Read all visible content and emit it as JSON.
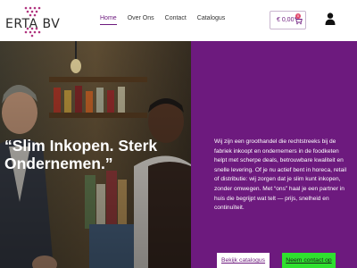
{
  "header": {
    "logo_text": "ERTA BV",
    "nav": [
      {
        "label": "Home",
        "active": true
      },
      {
        "label": "Over Ons",
        "active": false
      },
      {
        "label": "Contact",
        "active": false
      },
      {
        "label": "Catalogus",
        "active": false
      }
    ],
    "cart": {
      "amount": "€ 0,00",
      "count": "0",
      "icon": "cart-icon"
    },
    "user_icon": "user-icon"
  },
  "hero": {
    "headline": "“Slim Inkopen. Sterk Ondernemen.”",
    "body": "Wij zijn een groothandel die rechtstreeks bij de fabriek inkoopt en ondernemers in de foodketen helpt met scherpe deals, betrouwbare kwaliteit en snelle levering. Of je nu actief bent in horeca, retail of distributie: wij zorgen dat je slim kunt inkopen, zonder omwegen. Met “ons” haal je een partner in huis die begrijpt wat telt — prijs, snelheid en continuïteit.",
    "buttons": {
      "catalog": "Bekijk catalogus",
      "contact": "Neem contact op"
    }
  },
  "colors": {
    "brand_purple": "#6d1a7e",
    "accent_green": "#2fe02f",
    "badge_pink": "#e04a6d"
  }
}
